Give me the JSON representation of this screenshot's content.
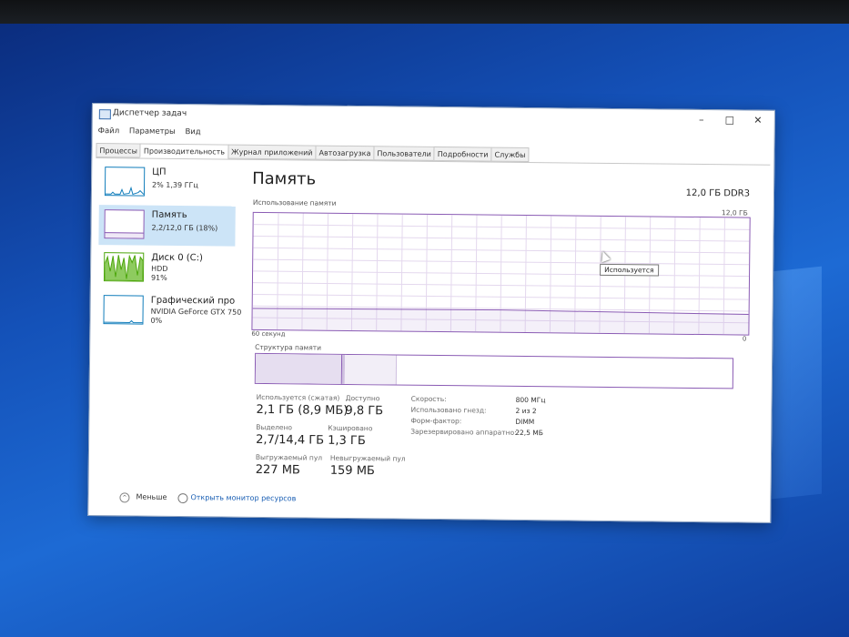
{
  "window": {
    "title": "Диспетчер задач",
    "controls": [
      "–",
      "□",
      "✕"
    ]
  },
  "menu": [
    "Файл",
    "Параметры",
    "Вид"
  ],
  "tabs": [
    "Процессы",
    "Производительность",
    "Журнал приложений",
    "Автозагрузка",
    "Пользователи",
    "Подробности",
    "Службы"
  ],
  "sidebar": [
    {
      "name": "ЦП",
      "sub": "2% 1,39 ГГц"
    },
    {
      "name": "Память",
      "sub": "2,2/12,0 ГБ (18%)"
    },
    {
      "name": "Диск 0 (C:)",
      "sub": "HDD",
      "sub2": "91%"
    },
    {
      "name": "Графический про",
      "sub": "NVIDIA GeForce GTX 750",
      "sub2": "0%"
    }
  ],
  "panel": {
    "title": "Память",
    "type": "12,0 ГБ DDR3",
    "usage_label": "Использование памяти",
    "usage_max": "12,0 ГБ",
    "axis_left": "60 секунд",
    "axis_right": "0",
    "tooltip": "Используется",
    "usage_fraction": 0.18,
    "structure_label": "Структура памяти"
  },
  "stats": {
    "in_use_label": "Используется (сжатая)",
    "in_use_value": "2,1 ГБ (8,9 МБ)",
    "available_label": "Доступно",
    "available_value": "9,8 ГБ",
    "committed_label": "Выделено",
    "committed_value": "2,7/14,4 ГБ",
    "cached_label": "Кэшировано",
    "cached_value": "1,3 ГБ",
    "paged_label": "Выгружаемый пул",
    "paged_value": "227 МБ",
    "nonpaged_label": "Невыгружаемый пул",
    "nonpaged_value": "159 МБ"
  },
  "specs": [
    {
      "k": "Скорость:",
      "v": "800 МГц"
    },
    {
      "k": "Использовано гнезд:",
      "v": "2 из 2"
    },
    {
      "k": "Форм-фактор:",
      "v": "DIMM"
    },
    {
      "k": "Зарезервировано аппаратно:",
      "v": "22,5 МБ"
    }
  ],
  "footer": {
    "less": "Меньше",
    "resource_monitor": "Открыть монитор ресурсов"
  },
  "colors": {
    "memory": "#8a5bb4",
    "cpu": "#117dbb",
    "disk": "#4da60c",
    "selected": "#cce4f7"
  }
}
